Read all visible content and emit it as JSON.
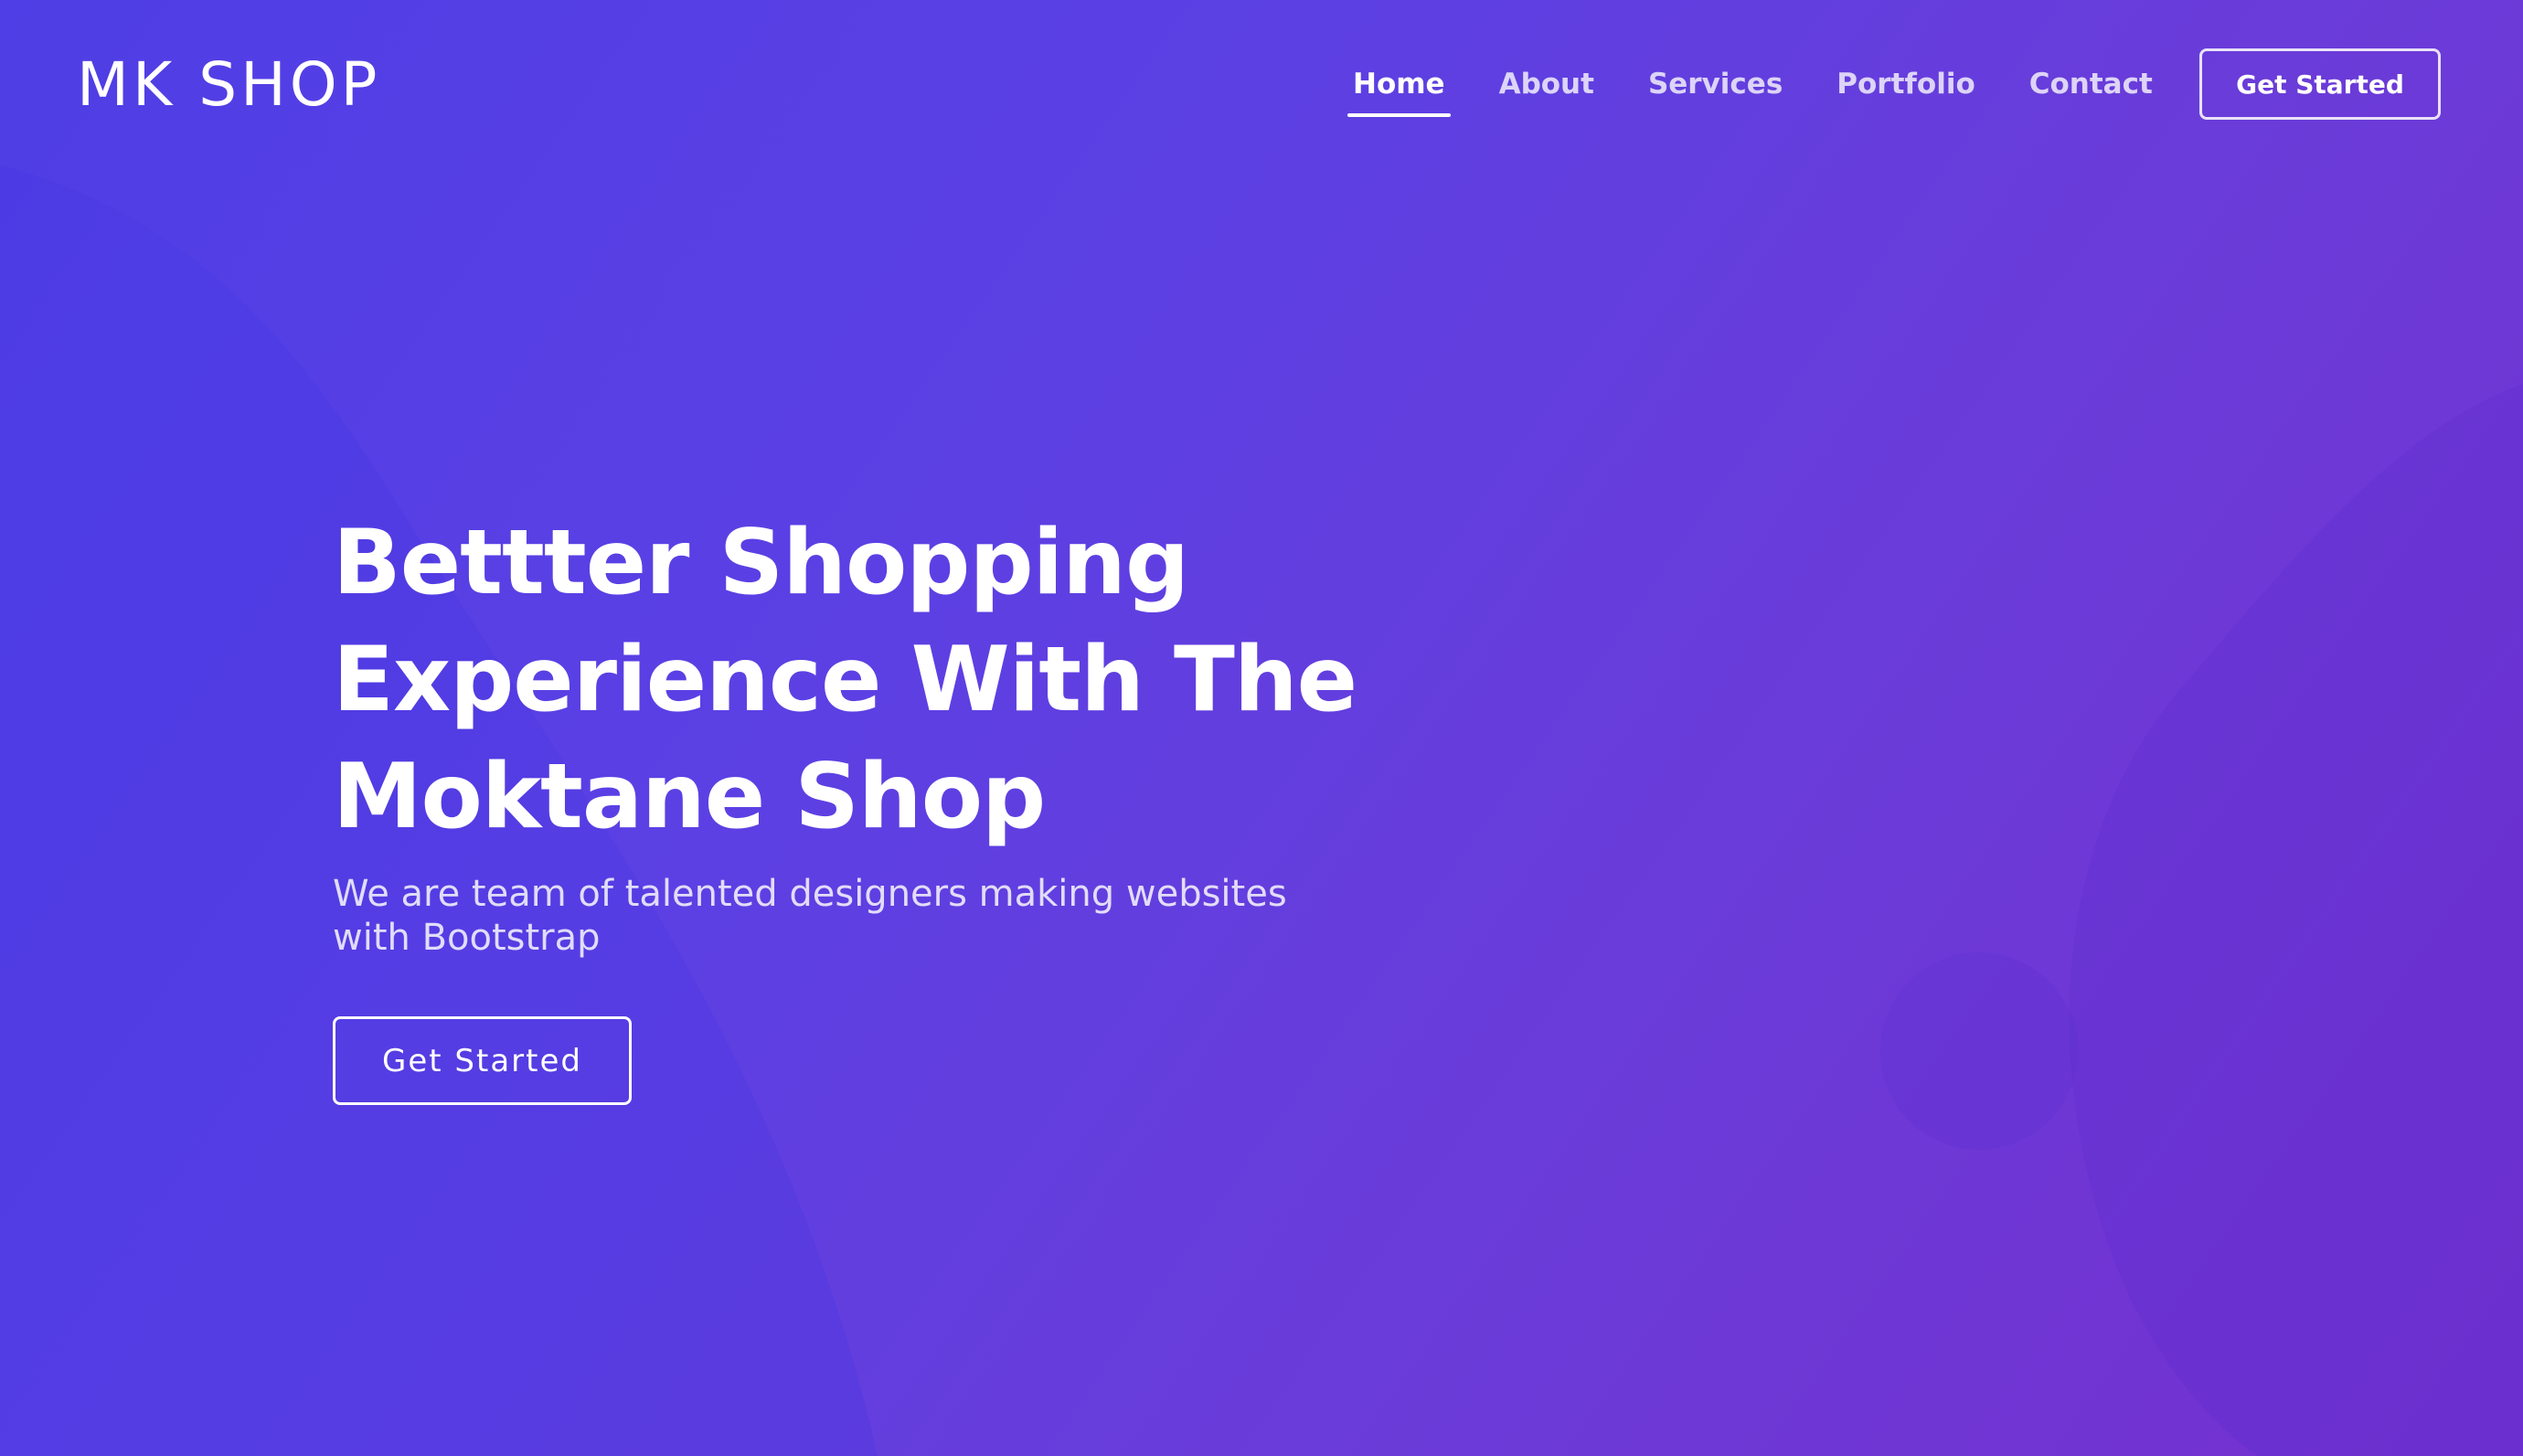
{
  "brand": {
    "logo_text": "MK SHOP"
  },
  "nav": {
    "items": [
      {
        "label": "Home",
        "active": true
      },
      {
        "label": "About",
        "active": false
      },
      {
        "label": "Services",
        "active": false
      },
      {
        "label": "Portfolio",
        "active": false
      },
      {
        "label": "Contact",
        "active": false
      }
    ],
    "cta_label": "Get Started"
  },
  "hero": {
    "title_lines": [
      "Bettter Shopping",
      "Experience With The",
      "Moktane Shop"
    ],
    "subtitle": "We are team of talented designers making websites with Bootstrap",
    "cta_label": "Get Started"
  },
  "colors": {
    "gradient_start": "#4f3ee5",
    "gradient_end": "#7430cf",
    "text": "#ffffff"
  }
}
